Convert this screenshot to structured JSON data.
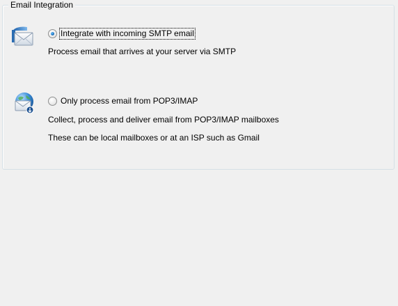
{
  "group": {
    "title": "Email Integration"
  },
  "options": [
    {
      "label": "Integrate with incoming SMTP email",
      "selected": true,
      "icon": "envelope-icon",
      "descriptions": [
        "Process email that arrives at your server via SMTP"
      ]
    },
    {
      "label": "Only process email from POP3/IMAP",
      "selected": false,
      "icon": "globe-envelope-icon",
      "descriptions": [
        "Collect, process and deliver email from POP3/IMAP mailboxes",
        "These can be local mailboxes or at an ISP such as Gmail"
      ]
    }
  ]
}
